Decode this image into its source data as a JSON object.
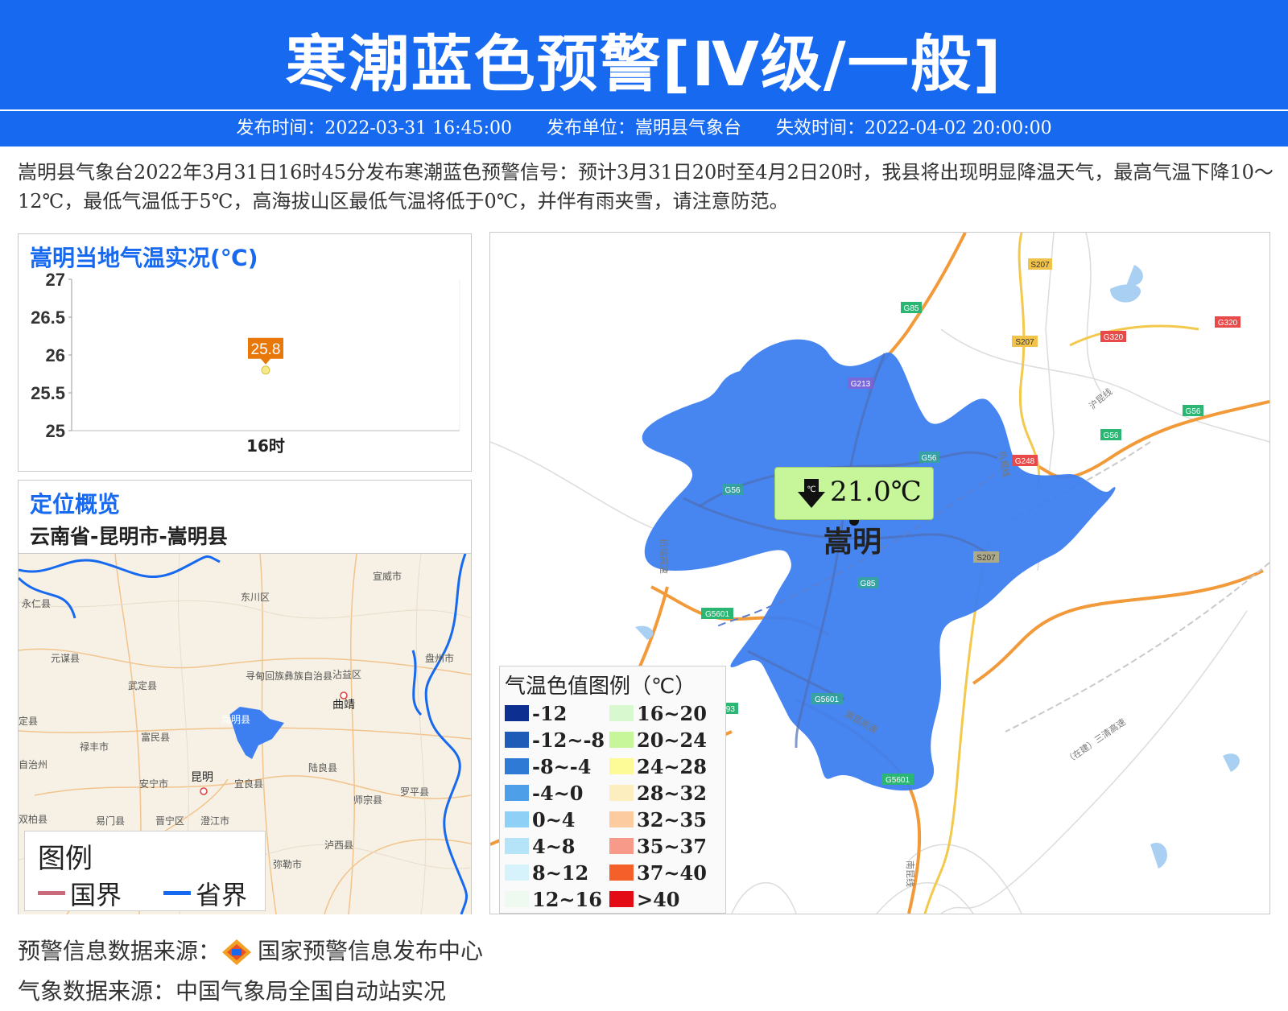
{
  "header": {
    "title": "寒潮蓝色预警[Ⅳ级/一般]",
    "publish_time": "发布时间：2022-03-31 16:45:00",
    "publisher": "发布单位：嵩明县气象台",
    "expire_time": "失效时间：2022-04-02 20:00:00"
  },
  "description": "嵩明县气象台2022年3月31日16时45分发布寒潮蓝色预警信号：预计3月31日20时至4月2日20时，我县将出现明显降温天气，最高气温下降10～12℃，最低气温低于5℃，高海拔山区最低气温将低于0℃，并伴有雨夹雪，请注意防范。",
  "temp_panel": {
    "title": "嵩明当地气温实况(℃)"
  },
  "chart_data": {
    "type": "scatter",
    "title": "嵩明当地气温实况(℃)",
    "categories": [
      "16时"
    ],
    "values": [
      25.8
    ],
    "data_labels": [
      "25.8"
    ],
    "yticks": [
      "27",
      "26.5",
      "26",
      "25.5",
      "25"
    ],
    "ylim": [
      25,
      27
    ],
    "grid": false,
    "colors": {
      "point": "#f5e98a",
      "label_bg": "#e8780a"
    }
  },
  "location_panel": {
    "title": "定位概览",
    "path": "云南省-昆明市-嵩明县",
    "map_labels": [
      "宣威市",
      "永仁县",
      "东川区",
      "元谋县",
      "盘州市",
      "武定县",
      "寻甸回族彝族自治县",
      "沾益区",
      "曲靖",
      "定县",
      "嵩明县",
      "富民县",
      "禄丰市",
      "安宁市",
      "昆明",
      "宜良县",
      "陆良县",
      "自治州",
      "罗平县",
      "师宗县",
      "双柏县",
      "易门县",
      "晋宁区",
      "澄江市",
      "泸西县",
      "弥勒市"
    ],
    "legend_title": "图例",
    "legend_items": [
      {
        "label": "国界",
        "color": "#c96b7a"
      },
      {
        "label": "省界",
        "color": "#1769f0"
      }
    ]
  },
  "main_map": {
    "temp_value": "21.0℃",
    "temp_icon": "arrow-down-celsius-icon",
    "county_name": "嵩明",
    "road_labels": [
      "S207",
      "G85",
      "G320",
      "S207",
      "G320",
      "G213",
      "G56",
      "G56",
      "G56",
      "G248",
      "G56",
      "S207",
      "G85",
      "G5601",
      "G5601",
      "G5601",
      "S93"
    ],
    "road_text": [
      "沪昆线",
      "杭瑞高速",
      "杭昆线",
      "嵩昆高速",
      "（在建）三清高速",
      "南昆线"
    ],
    "colors": {
      "county_fill": "#3d7ff0",
      "badge_bg": "#c7f59a"
    }
  },
  "temp_legend": {
    "title": "气温色值图例（℃）",
    "items": [
      {
        "label": "-12",
        "color": "#0d2f8f"
      },
      {
        "label": "-12~-8",
        "color": "#1f5cb8"
      },
      {
        "label": "-8~-4",
        "color": "#2f7ad4"
      },
      {
        "label": "-4~0",
        "color": "#4d9fe8"
      },
      {
        "label": "0~4",
        "color": "#8fd0f6"
      },
      {
        "label": "4~8",
        "color": "#b5e3f8"
      },
      {
        "label": "8~12",
        "color": "#d6f3fb"
      },
      {
        "label": "12~16",
        "color": "#eefaf0"
      },
      {
        "label": "16~20",
        "color": "#d8f9cf"
      },
      {
        "label": "20~24",
        "color": "#c7f59a"
      },
      {
        "label": "24~28",
        "color": "#fdfb98"
      },
      {
        "label": "28~32",
        "color": "#fdeec0"
      },
      {
        "label": "32~35",
        "color": "#fccb9f"
      },
      {
        "label": "35~37",
        "color": "#f79a8a"
      },
      {
        "label": "37~40",
        "color": "#f5602a"
      },
      {
        "label": ">40",
        "color": "#e30c16"
      }
    ]
  },
  "footer": {
    "warning_source": "预警信息数据来源：",
    "warning_source_name": "国家预警信息发布中心",
    "weather_source": "气象数据来源：中国气象局全国自动站实况"
  }
}
